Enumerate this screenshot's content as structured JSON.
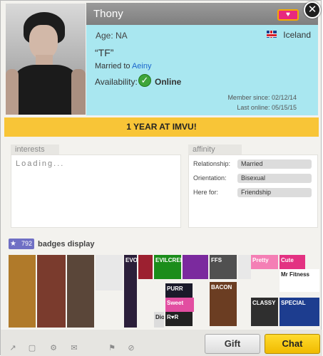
{
  "profile": {
    "name": "Thony",
    "vip_badge": "♥",
    "age": "Age: NA",
    "country": "Iceland",
    "tagline": "“TF”",
    "married_prefix": "Married to ",
    "married_to": "Aeiny",
    "availability_label": "Availability:",
    "status": "Online",
    "member_since": "Member since: 02/12/14",
    "last_online": "Last online: 05/15/15",
    "close_symbol": "✕"
  },
  "banner": {
    "text": "1 YEAR AT IMVU!"
  },
  "interests": {
    "label": "interests",
    "content": "Loading..."
  },
  "affinity": {
    "label": "affinity",
    "rows": [
      {
        "label": "Relationship:",
        "value": "Married"
      },
      {
        "label": "Orientation:",
        "value": "Bisexual"
      },
      {
        "label": "Here for:",
        "value": "Friendship"
      }
    ]
  },
  "badges": {
    "count": "792",
    "title": "badges display",
    "items": [
      {
        "text": "",
        "color": "#b07a2a"
      },
      {
        "text": "",
        "color": "#7a3b2d"
      },
      {
        "text": "",
        "color": "#5a4639"
      },
      {
        "text": "",
        "color": "#e8e8e8"
      },
      {
        "text": "EVOLUTION",
        "color": "#2b1f3a"
      },
      {
        "text": "",
        "color": "#9c2030"
      },
      {
        "text": "EVILCREDITS",
        "color": "#1b8d1b"
      },
      {
        "text": "",
        "color": "#7b2a9e"
      },
      {
        "text": "FFS",
        "color": "#505050"
      },
      {
        "text": "",
        "color": "#e8e8e8"
      },
      {
        "text": "Pretty",
        "color": "#f47fb5"
      },
      {
        "text": "Cute",
        "color": "#e33282"
      },
      {
        "text": "Mr Fitness",
        "color": "#ffffff"
      },
      {
        "text": "PURR",
        "color": "#1a1a2a"
      },
      {
        "text": "Sweet",
        "color": "#e24ea1"
      },
      {
        "text": "R♥R",
        "color": "#222222"
      },
      {
        "text": "BACON",
        "color": "#6b3d22"
      },
      {
        "text": "CLASSY",
        "color": "#2f2f2f"
      },
      {
        "text": "SPECIAL",
        "color": "#1d3d8f"
      },
      {
        "text": "Dior",
        "color": "#dcdcdc"
      }
    ]
  },
  "footer": {
    "icons": [
      "↗",
      "▢",
      "⚙",
      "✉",
      "⚑",
      "⊘"
    ],
    "gift_label": "Gift",
    "chat_label": "Chat"
  }
}
